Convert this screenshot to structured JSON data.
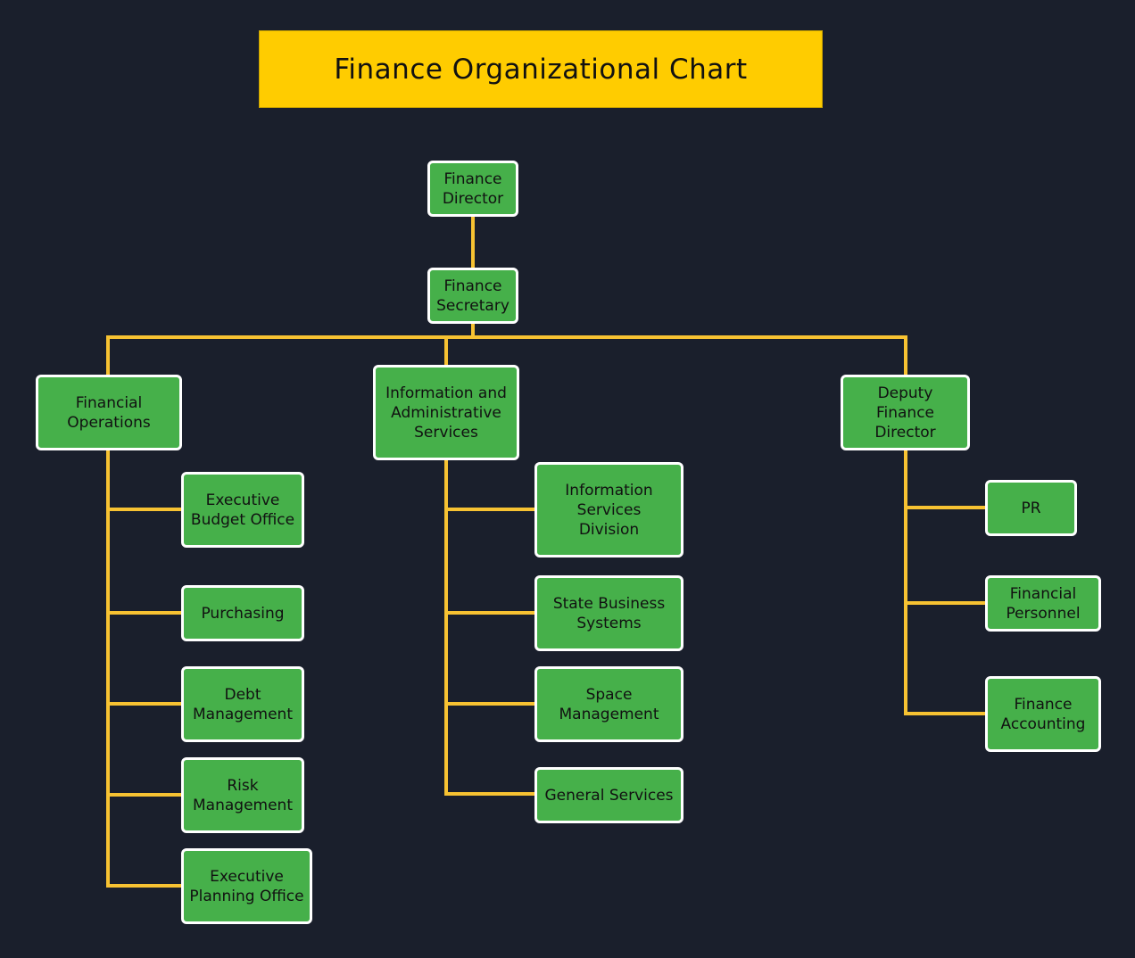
{
  "title": "Finance Organizational Chart",
  "colors": {
    "background": "#1a1f2c",
    "title_fill": "#ffcc00",
    "node_fill": "#46b04a",
    "node_border": "#ffffff",
    "connector": "#f7c232"
  },
  "nodes": {
    "finance_director": "Finance\nDirector",
    "finance_secretary": "Finance\nSecretary",
    "financial_operations": "Financial\nOperations",
    "info_admin_services": "Information and\nAdministrative\nServices",
    "deputy_finance_director": "Deputy\nFinance\nDirector",
    "executive_budget_office": "Executive\nBudget Office",
    "purchasing": "Purchasing",
    "debt_management": "Debt\nManagement",
    "risk_management": "Risk\nManagement",
    "executive_planning_office": "Executive\nPlanning Office",
    "information_services_division": "Information\nServices\nDivision",
    "state_business_systems": "State Business\nSystems",
    "space_management": "Space\nManagement",
    "general_services": "General Services",
    "pr": "PR",
    "financial_personnel": "Financial\nPersonnel",
    "finance_accounting": "Finance\nAccounting"
  },
  "hierarchy": {
    "Finance Director": [
      "Finance Secretary"
    ],
    "Finance Secretary": [
      "Financial Operations",
      "Information and Administrative Services",
      "Deputy Finance Director"
    ],
    "Financial Operations": [
      "Executive Budget Office",
      "Purchasing",
      "Debt Management",
      "Risk Management",
      "Executive Planning Office"
    ],
    "Information and Administrative Services": [
      "Information Services Division",
      "State Business Systems",
      "Space Management",
      "General Services"
    ],
    "Deputy Finance Director": [
      "PR",
      "Financial Personnel",
      "Finance Accounting"
    ]
  }
}
